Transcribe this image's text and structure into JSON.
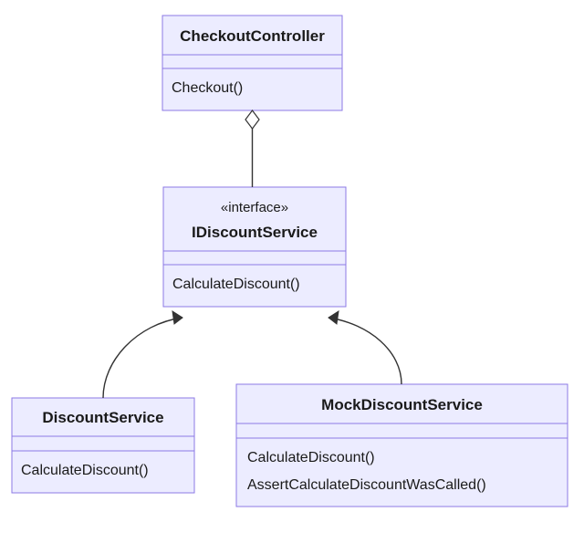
{
  "classes": {
    "checkoutController": {
      "name": "CheckoutController",
      "members": [
        "Checkout()"
      ]
    },
    "iDiscountService": {
      "stereotype": "«interface»",
      "name": "IDiscountService",
      "members": [
        "CalculateDiscount()"
      ]
    },
    "discountService": {
      "name": "DiscountService",
      "members": [
        "CalculateDiscount()"
      ]
    },
    "mockDiscountService": {
      "name": "MockDiscountService",
      "members": [
        "CalculateDiscount()",
        "AssertCalculateDiscountWasCalled()"
      ]
    }
  }
}
